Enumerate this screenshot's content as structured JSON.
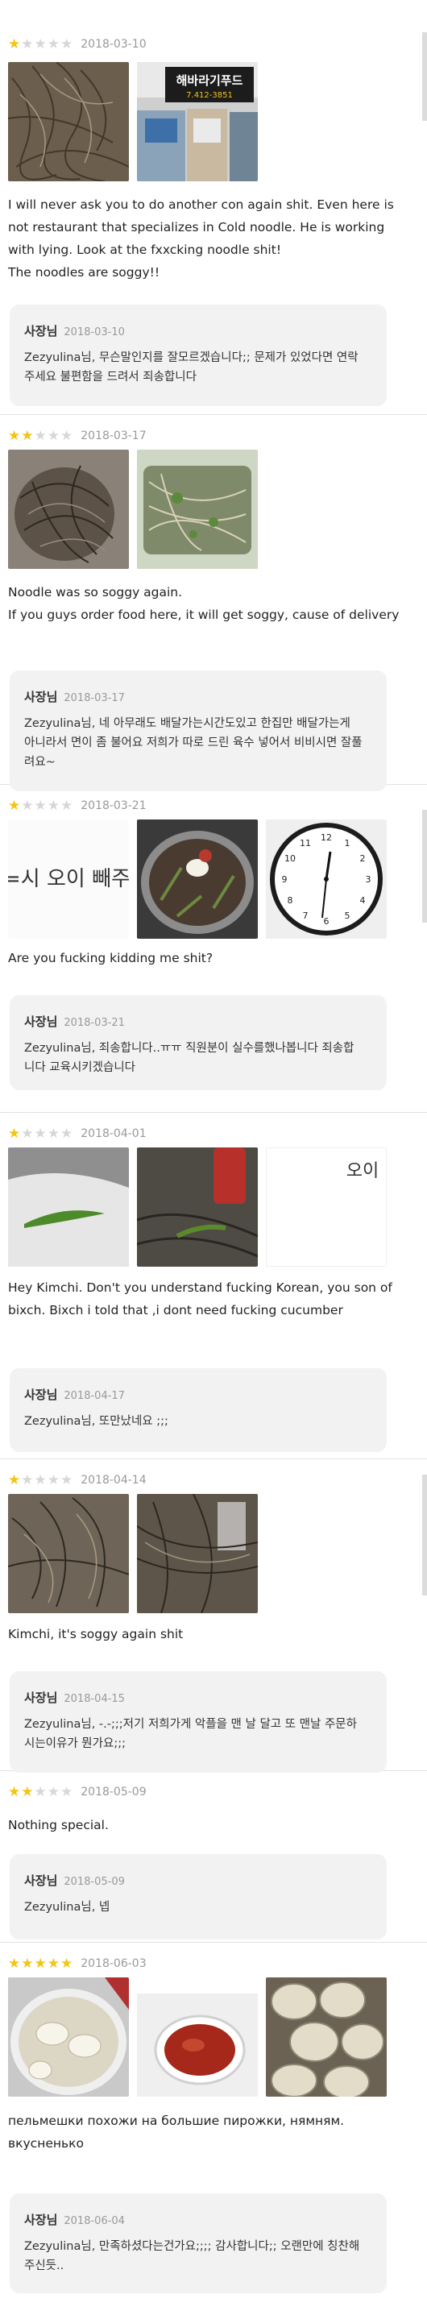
{
  "owner_label": "사장님",
  "star_glyph": "★",
  "colors": {
    "star_on": "#f3c413",
    "star_off": "#d7d7d7",
    "reply_bg": "#f2f2f2"
  },
  "photo_texts": {
    "storefront_sign_name": "해바라기푸드",
    "storefront_sign_phone": "7.412-3851",
    "menu_sign": "=시 오이 빼주",
    "paper_text": "오이",
    "clock_numbers": [
      "12",
      "1",
      "2",
      "3",
      "4",
      "5",
      "6",
      "7",
      "8",
      "9",
      "10",
      "11"
    ]
  },
  "reviews": [
    {
      "rating": 1,
      "date": "2018-03-10",
      "photos": [
        "soggy-noodles-photo",
        "storefront-photo"
      ],
      "text": "I will never ask you to do another con again shit. Even here is not restaurant that specializes in Cold noodle. He is working with lying. Look at the fxxcking noodle shit!\nThe noodles are soggy!!",
      "reply": {
        "date": "2018-03-10",
        "text": "Zezyulina님, 무슨말인지를 잘모르겠습니다;; 문제가 있었다면 연락주세요 불편함을 드려서 죄송합니다"
      }
    },
    {
      "rating": 2,
      "date": "2018-03-17",
      "photos": [
        "noodle-clump-photo",
        "noodle-container-photo"
      ],
      "text": "Noodle was so soggy again.\nIf you guys order food here, it will get soggy, cause of delivery",
      "reply": {
        "date": "2018-03-17",
        "text": "Zezyulina님, 네 아무래도 배달가는시간도있고 한집만 배달가는게 아니라서  면이 좀 불어요 저희가 따로 드린 육수 넣어서 비비시면 잘풀려요~"
      }
    },
    {
      "rating": 1,
      "date": "2018-03-21",
      "photos": [
        "menu-sign-photo",
        "cold-noodle-bowl-photo",
        "wall-clock-photo"
      ],
      "text": "Are you fucking kidding me shit?",
      "reply": {
        "date": "2018-03-21",
        "text": "Zezyulina님, 죄송합니다..ㅠㅠ  직원분이 실수를했나봅니다 죄송합니다 교육시키겠습니다"
      }
    },
    {
      "rating": 1,
      "date": "2018-04-01",
      "photos": [
        "cucumber-photo",
        "dark-noodles-photo",
        "paper-note-photo"
      ],
      "text": "Hey Kimchi. Don't you understand fucking Korean, you son of bixch. Bixch i told that ,i dont need fucking cucumber",
      "reply": {
        "date": "2018-04-17",
        "text": "Zezyulina님, 또만났네요 ;;;"
      }
    },
    {
      "rating": 1,
      "date": "2018-04-14",
      "photos": [
        "noodle-clump-photo",
        "noodles-bowl-photo"
      ],
      "text": "Kimchi, it's soggy again shit",
      "reply": {
        "date": "2018-04-15",
        "text": "Zezyulina님, -.-;;;저기 저희가게 악플을 맨 날 달고 또 맨날 주문하시는이유가 뭔가요;;;"
      }
    },
    {
      "rating": 2,
      "date": "2018-05-09",
      "photos": [],
      "text": "Nothing special.",
      "reply": {
        "date": "2018-05-09",
        "text": "Zezyulina님, 넵"
      }
    },
    {
      "rating": 5,
      "date": "2018-06-03",
      "photos": [
        "dumpling-soup-photo",
        "sauce-cup-photo",
        "dumplings-photo"
      ],
      "text": "пельмешки похожи на большие пирожки, нямням. вкусненько",
      "reply": {
        "date": "2018-06-04",
        "text": "Zezyulina님, 만족하셨다는건가요;;;; 감사합니다;; 오랜만에 칭찬해주신듯.."
      }
    }
  ]
}
